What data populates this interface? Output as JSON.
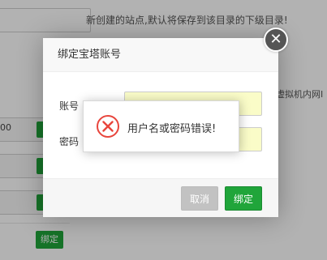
{
  "background": {
    "hint": "新创建的站点,默认将保存到该目录的下级目录!",
    "side_text": "虚拟机内网I",
    "row_value": "00",
    "bind_button_label": "绑定"
  },
  "dialog": {
    "title": "绑定宝塔账号",
    "close_symbol": "✕",
    "account_label": "账号",
    "password_label": "密码",
    "account_value": "",
    "password_value": "",
    "cancel_label": "取消",
    "confirm_label": "绑定"
  },
  "toast": {
    "message": "用户名或密码错误!",
    "icon": "error-circle-icon",
    "icon_color": "#e8453c"
  },
  "colors": {
    "brand_green": "#20a53a",
    "input_bg": "#fafcc8",
    "overlay": "rgba(0,0,0,0.3)"
  }
}
